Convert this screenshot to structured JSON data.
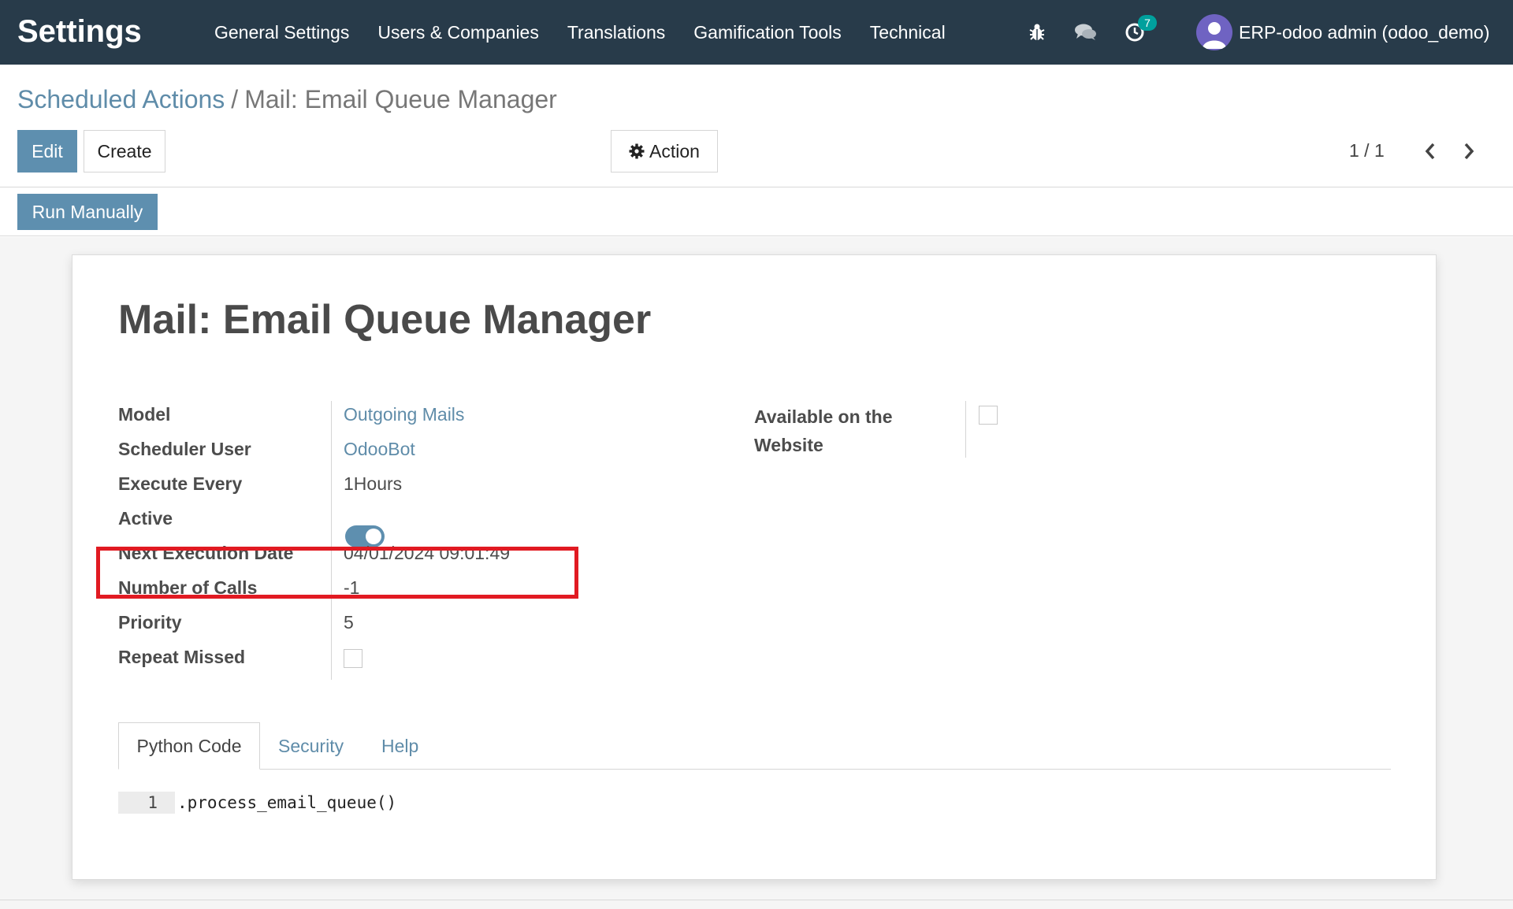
{
  "navbar": {
    "brand": "Settings",
    "menu": [
      "General Settings",
      "Users & Companies",
      "Translations",
      "Gamification Tools",
      "Technical"
    ],
    "icons": [
      "bug-icon",
      "chat-icon",
      "clock-icon"
    ],
    "activity_count": "7",
    "user_name": "ERP-odoo admin (odoo_demo)"
  },
  "breadcrumb": {
    "parent": "Scheduled Actions",
    "separator": "/",
    "current": "Mail: Email Queue Manager"
  },
  "toolbar": {
    "edit_label": "Edit",
    "create_label": "Create",
    "action_label": "Action",
    "pager": "1 / 1"
  },
  "statusbar": {
    "run_label": "Run Manually"
  },
  "record": {
    "title": "Mail: Email Queue Manager",
    "fields": {
      "model_label": "Model",
      "model_value": "Outgoing Mails",
      "user_label": "Scheduler User",
      "user_value": "OdooBot",
      "interval_label": "Execute Every",
      "interval_value": "1Hours",
      "active_label": "Active",
      "active_value": true,
      "nextcall_label": "Next Execution Date",
      "nextcall_value": "04/01/2024 09:01:49",
      "numcall_label": "Number of Calls",
      "numcall_value": "-1",
      "priority_label": "Priority",
      "priority_value": "5",
      "missed_label": "Repeat Missed",
      "missed_value": false,
      "website_label": "Available on the Website",
      "website_value": false
    },
    "tabs": [
      "Python Code",
      "Security",
      "Help"
    ],
    "code": {
      "line_number": "1",
      "line": ".process_email_queue()"
    }
  },
  "colors": {
    "navbar": "#283b4a",
    "primary": "#5e8faf",
    "link": "#5f8ca9",
    "highlight": "#e11a22",
    "badge": "#00a09d"
  }
}
